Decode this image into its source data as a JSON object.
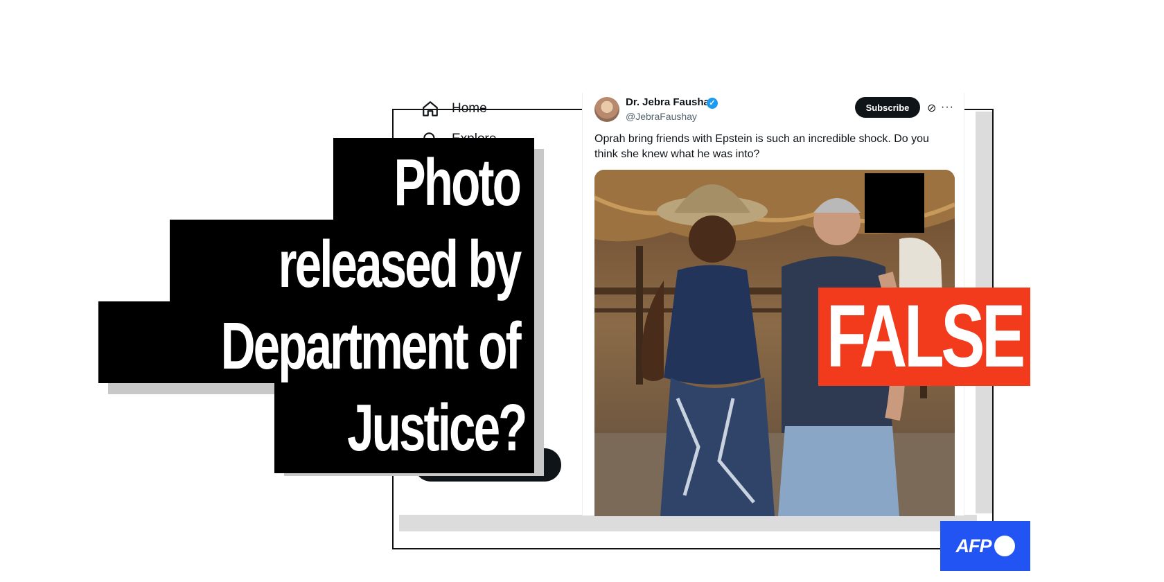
{
  "nav": {
    "items": [
      {
        "label": "Home",
        "icon": "home-icon"
      },
      {
        "label": "Explore",
        "icon": "search-icon"
      }
    ]
  },
  "tweet": {
    "author_name": "Dr. Jebra Faushay",
    "author_handle": "@JebraFaushay",
    "subscribe_label": "Subscribe",
    "text": "Oprah bring friends with Epstein is such an incredible shock. Do you think she knew what he was into?"
  },
  "headline": {
    "lines": [
      "Photo",
      "released by",
      "Department of",
      "Justice?"
    ]
  },
  "verdict": {
    "label": "FALSE",
    "color": "#f23b1d"
  },
  "brand": {
    "logo_text": "AFP",
    "color": "#2254f4"
  }
}
